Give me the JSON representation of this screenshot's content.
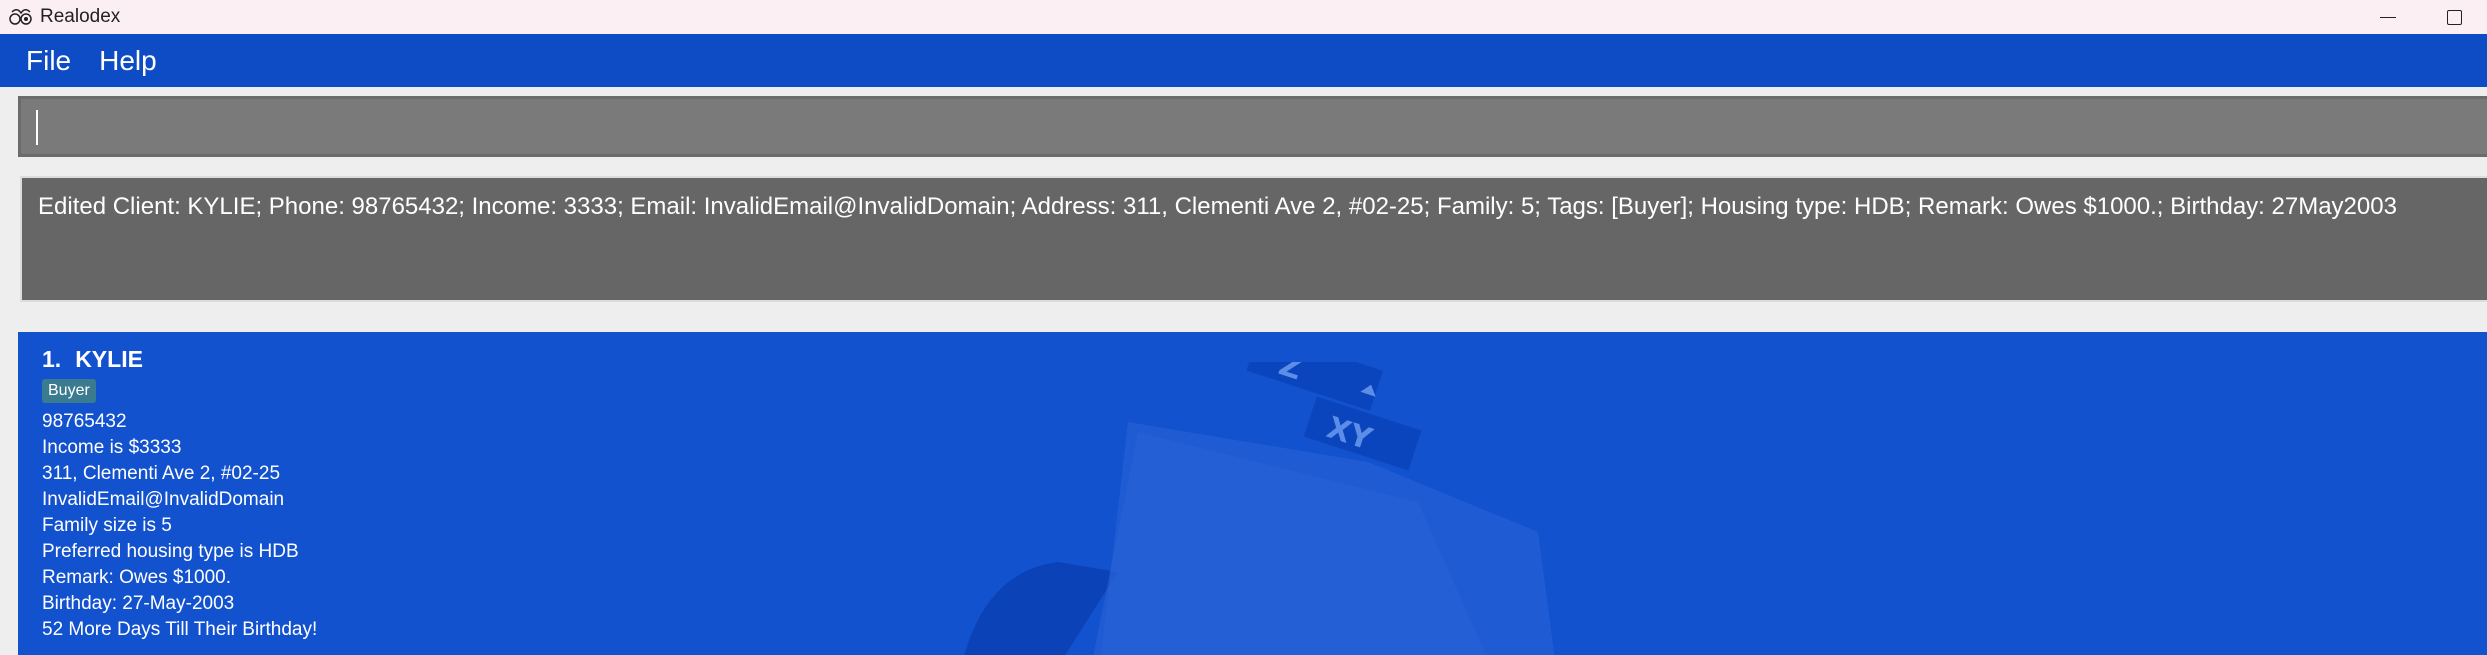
{
  "window": {
    "title": "Realodex"
  },
  "menu": {
    "items": [
      "File",
      "Help"
    ]
  },
  "command": {
    "value": "",
    "placeholder": ""
  },
  "result": {
    "text": "Edited Client: KYLIE; Phone: 98765432; Income: 3333; Email: InvalidEmail@InvalidDomain; Address: 311, Clementi Ave 2, #02-25; Family: 5; Tags: [Buyer]; Housing type: HDB; Remark: Owes $1000.; Birthday: 27May2003"
  },
  "clients": [
    {
      "index": "1.",
      "name": "KYLIE",
      "tag": "Buyer",
      "phone": "98765432",
      "income": "Income is $3333",
      "address": "311, Clementi Ave 2, #02-25",
      "email": "InvalidEmail@InvalidDomain",
      "family": "Family size is 5",
      "housing": "Preferred housing type is HDB",
      "remark": "Remark: Owes $1000.",
      "birthday": "Birthday: 27-May-2003",
      "countdown": "52 More Days Till Their Birthday!"
    }
  ],
  "colors": {
    "menubar": "#0e4cc6",
    "list_background": "#1252cf",
    "result_background": "#666666",
    "tag_background": "#3a7b8f"
  },
  "icons": {
    "app": "realodex-app-icon",
    "minimize": "minimize-icon",
    "maximize": "maximize-icon"
  }
}
